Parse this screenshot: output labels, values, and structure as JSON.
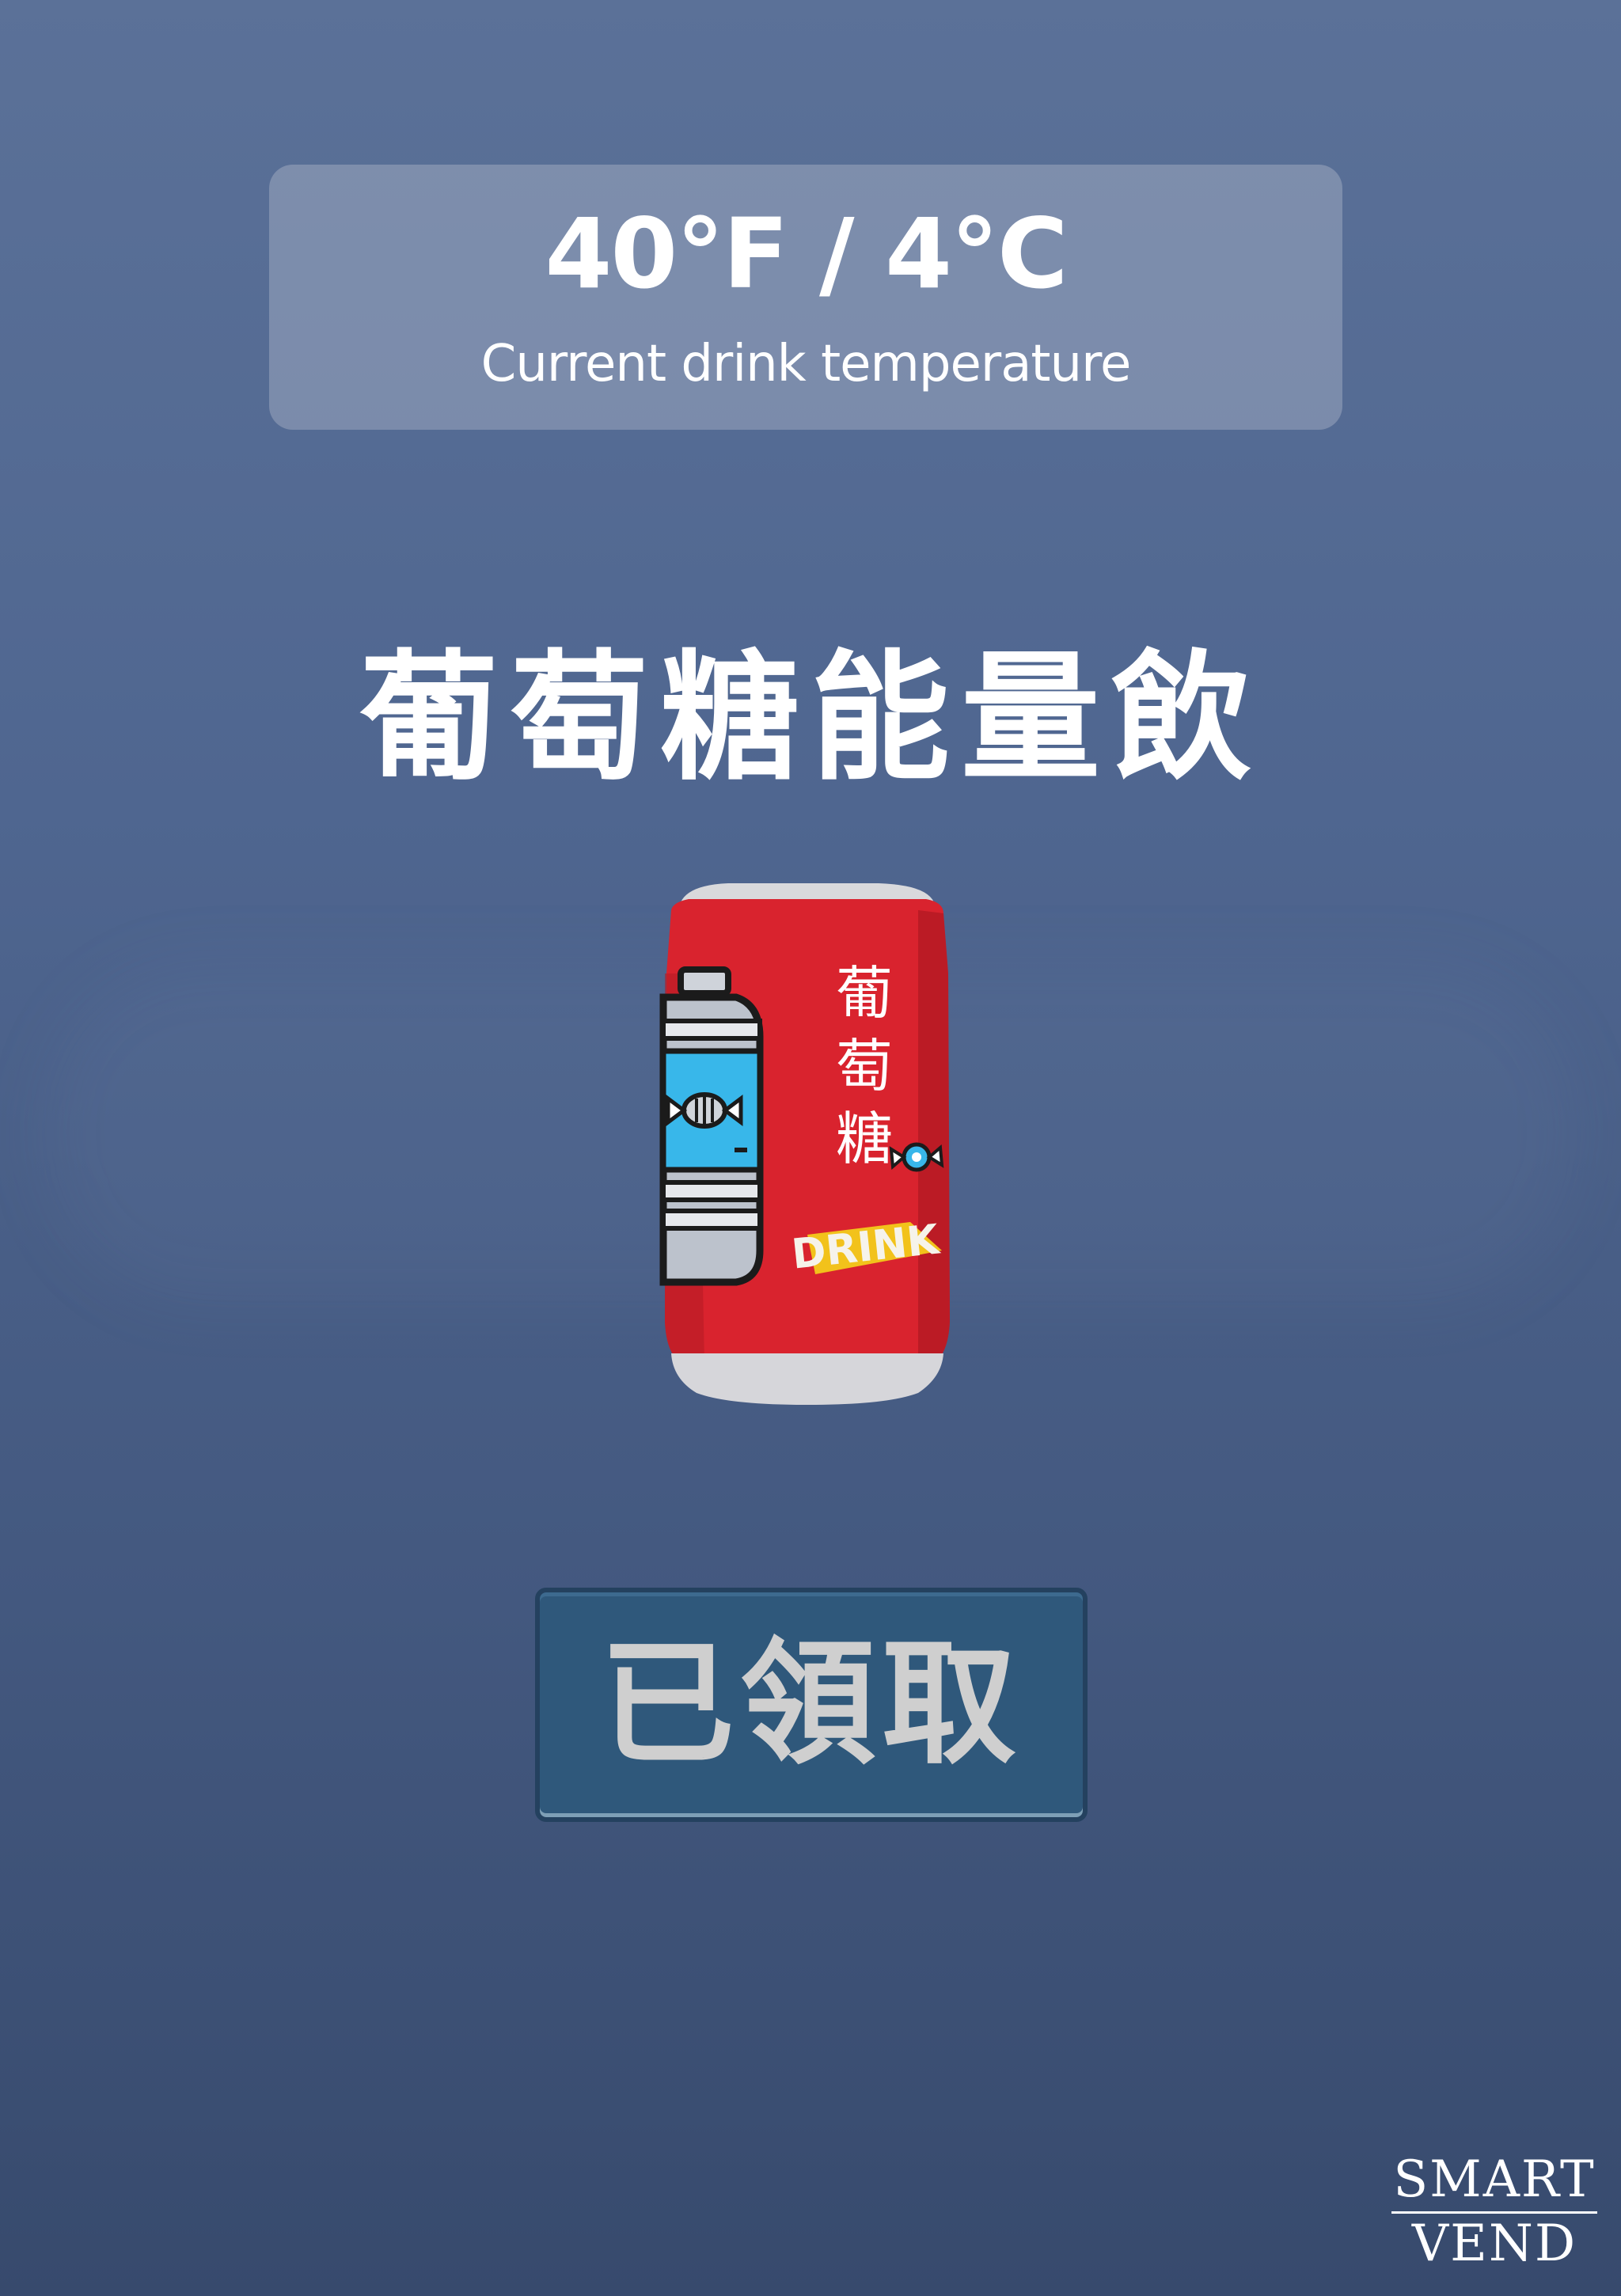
{
  "temperature": {
    "value": "40°F / 4°C",
    "caption": "Current drink temperature"
  },
  "product": {
    "name": "葡萄糖能量飲",
    "can_label_chinese": "葡萄糖",
    "can_label_chinese_chars": [
      "葡",
      "萄",
      "糖"
    ],
    "can_label_english": "DRINK",
    "can_icon": "candy-icon"
  },
  "actions": {
    "claim_label": "已領取"
  },
  "brand": {
    "line1": "SMART",
    "line2": "VEND"
  },
  "colors": {
    "background": "#4f6690",
    "button": "#2f587b",
    "can_red": "#d9232e",
    "can_accent_yellow": "#f2c21b",
    "bottle_blue": "#38b7ea"
  }
}
